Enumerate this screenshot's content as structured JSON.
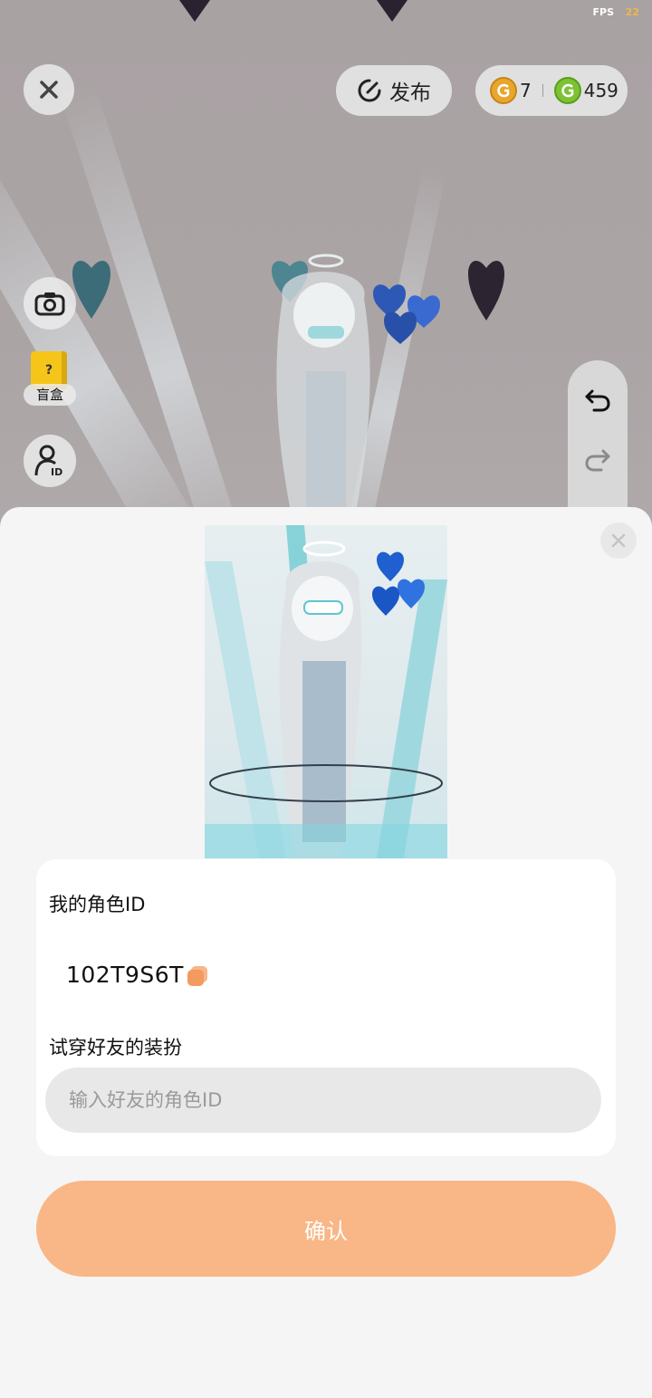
{
  "hud": {
    "fps_label": "FPS",
    "fps_value": "22",
    "publish_label": "发布",
    "gold_coins": "7",
    "green_coins": "459",
    "blind_box_label": "盲盒",
    "blind_box_glyph": "?"
  },
  "icons": {
    "close_top": "close-icon",
    "publish": "publish-icon",
    "gold_coin": "gold-coin-icon",
    "green_coin": "green-coin-icon",
    "camera": "camera-icon",
    "role_id": "user-id-icon",
    "undo": "undo-icon",
    "redo": "redo-icon",
    "copy": "copy-icon"
  },
  "colors": {
    "accent_orange": "#f9b686",
    "gold": "#e9a62c",
    "green": "#7dc233"
  },
  "sheet": {
    "my_id_title": "我的角色ID",
    "my_id_value": "102T9S6T",
    "tryon_title": "试穿好友的装扮",
    "input_placeholder": "输入好友的角色ID",
    "input_value": "",
    "confirm_label": "确认"
  }
}
